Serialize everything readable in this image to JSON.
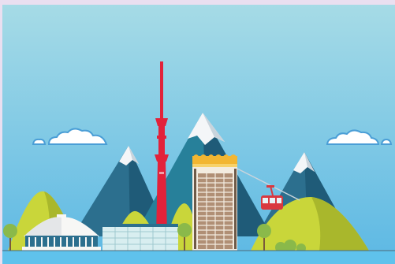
{
  "scene": {
    "kind": "flat vector city skyline illustration",
    "icons": [
      "sky-background",
      "cloud-icon",
      "mountain-icon",
      "tv-tower-icon",
      "hotel-tower-icon",
      "cable-car-icon",
      "dome-building-icon",
      "glass-office-icon",
      "tree-icon",
      "hill-icon"
    ]
  },
  "colors": {
    "frame": "#eadff0",
    "sky_top": "#a6dbe6",
    "sky_bottom": "#5cb8e4",
    "mountain_dark": "#2c6f8e",
    "mountain_mid": "#27809a",
    "mountain_shadow": "#1f5b78",
    "snow": "#f4f6f8",
    "snow_shade": "#c9d4dc",
    "hill_light": "#c9d63a",
    "hill_dark": "#a9b72c",
    "tower_red": "#e2223a",
    "hotel_body": "#f3ece0",
    "hotel_window": "#b08f75",
    "hotel_crown": "#f2b632",
    "cable_car_red": "#d9383f",
    "ground": "#5fc2ec",
    "tree_green": "#8ab94a",
    "trunk": "#7a5a3a",
    "cloud_outline": "#4a9ed6",
    "dome_roof": "#f7f7f5",
    "glass": "#d8eef0"
  }
}
